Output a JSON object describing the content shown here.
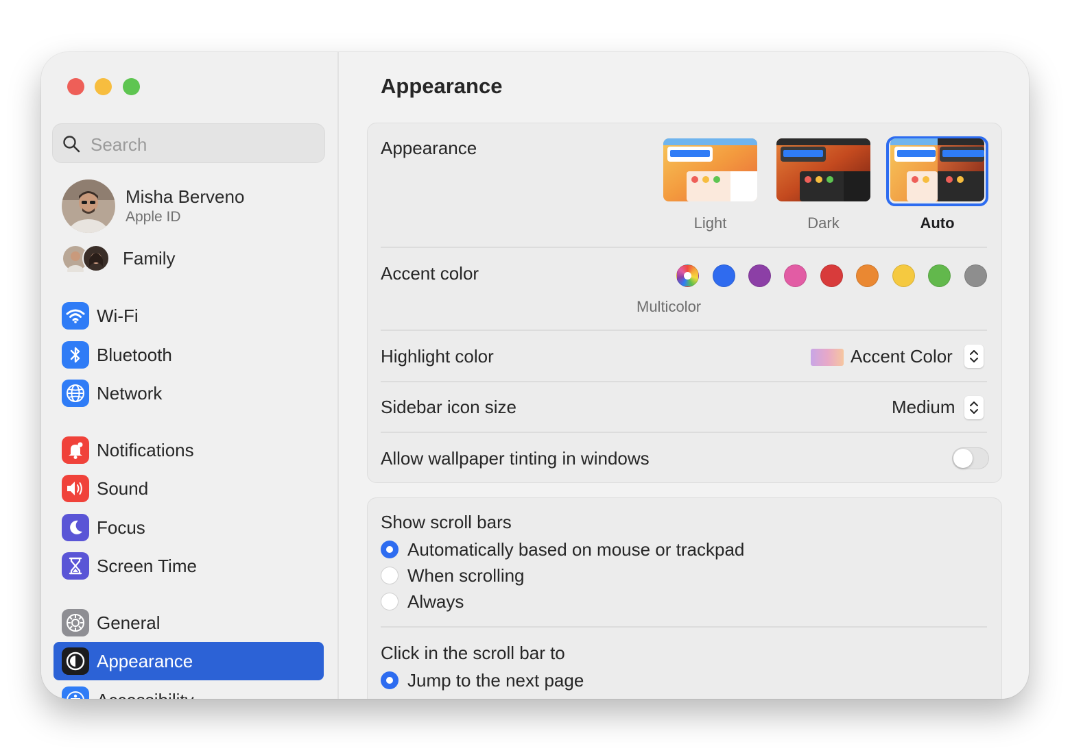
{
  "sidebar": {
    "search_placeholder": "Search",
    "profile": {
      "name": "Misha Berveno",
      "subtitle": "Apple ID"
    },
    "family_label": "Family",
    "items": [
      {
        "label": "Wi-Fi",
        "icon": "wifi-icon",
        "color": "#2f7cf6"
      },
      {
        "label": "Bluetooth",
        "icon": "bluetooth-icon",
        "color": "#2f7cf6"
      },
      {
        "label": "Network",
        "icon": "globe-icon",
        "color": "#2f7cf6"
      },
      {
        "label": "Notifications",
        "icon": "bell-icon",
        "color": "#f0423a"
      },
      {
        "label": "Sound",
        "icon": "speaker-icon",
        "color": "#f0423a"
      },
      {
        "label": "Focus",
        "icon": "moon-icon",
        "color": "#5a55d6"
      },
      {
        "label": "Screen Time",
        "icon": "hourglass-icon",
        "color": "#5a55d6"
      },
      {
        "label": "General",
        "icon": "gear-icon",
        "color": "#8e8e93"
      },
      {
        "label": "Appearance",
        "icon": "appearance-icon",
        "color": "#1c1c1e",
        "selected": true
      },
      {
        "label": "Accessibility",
        "icon": "accessibility-icon",
        "color": "#2f7cf6"
      }
    ]
  },
  "main": {
    "title": "Appearance",
    "appearance": {
      "label": "Appearance",
      "options": [
        {
          "label": "Light",
          "selected": false
        },
        {
          "label": "Dark",
          "selected": false
        },
        {
          "label": "Auto",
          "selected": true
        }
      ]
    },
    "accent": {
      "label": "Accent color",
      "selected_name": "Multicolor",
      "colors": [
        "multicolor",
        "#2f6bef",
        "#8c3fa6",
        "#e25ca4",
        "#d83b3b",
        "#ea8832",
        "#f5c940",
        "#62b84c",
        "#8e8e8e"
      ]
    },
    "highlight": {
      "label": "Highlight color",
      "value": "Accent Color"
    },
    "sidebar_icon_size": {
      "label": "Sidebar icon size",
      "value": "Medium"
    },
    "wallpaper_tinting": {
      "label": "Allow wallpaper tinting in windows",
      "enabled": false
    },
    "scroll_bars": {
      "label": "Show scroll bars",
      "options": [
        {
          "label": "Automatically based on mouse or trackpad",
          "selected": true
        },
        {
          "label": "When scrolling",
          "selected": false
        },
        {
          "label": "Always",
          "selected": false
        }
      ]
    },
    "click_scroll": {
      "label": "Click in the scroll bar to",
      "options": [
        {
          "label": "Jump to the next page",
          "selected": true
        }
      ]
    }
  }
}
